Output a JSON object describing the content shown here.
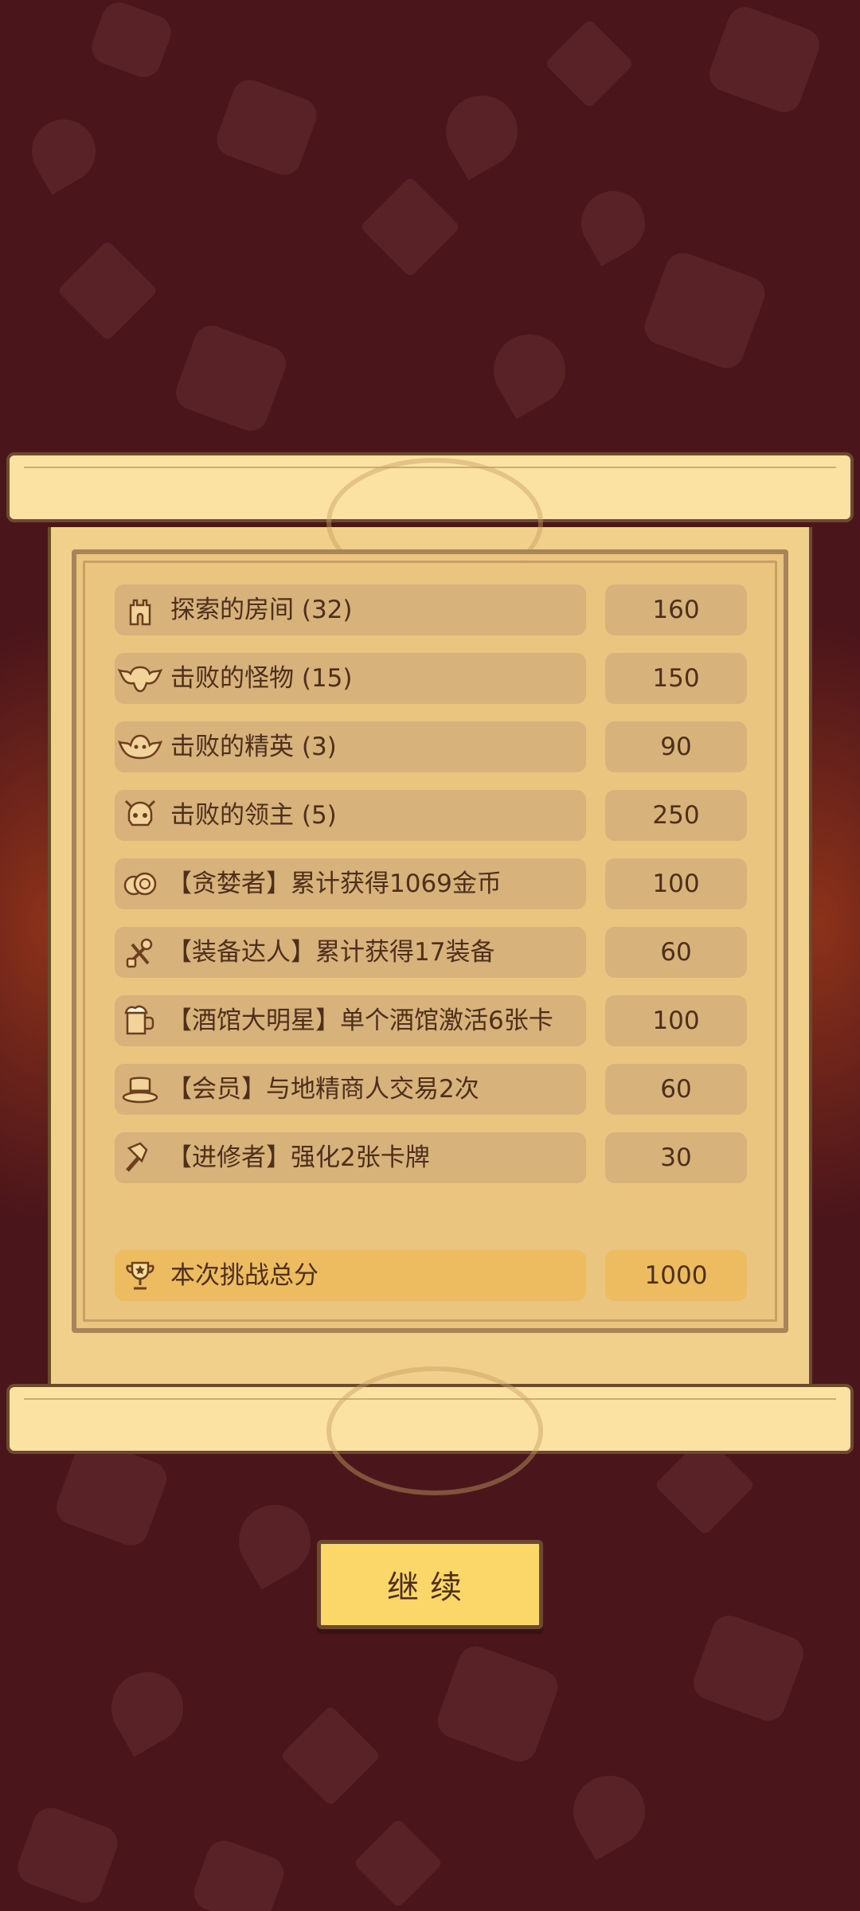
{
  "stats": {
    "rows": [
      {
        "icon": "tower-icon",
        "label": "探索的房间 (32)",
        "value": "160"
      },
      {
        "icon": "bat-icon",
        "label": "击败的怪物 (15)",
        "value": "150"
      },
      {
        "icon": "elite-monster-icon",
        "label": "击败的精英 (3)",
        "value": "90"
      },
      {
        "icon": "boss-skull-icon",
        "label": "击败的领主 (5)",
        "value": "250"
      },
      {
        "icon": "coins-icon",
        "label": "【贪婪者】累计获得1069金币",
        "value": "100"
      },
      {
        "icon": "equipment-icon",
        "label": "【装备达人】累计获得17装备",
        "value": "60"
      },
      {
        "icon": "beer-mug-icon",
        "label": "【酒馆大明星】单个酒馆激活6张卡",
        "value": "100"
      },
      {
        "icon": "top-hat-icon",
        "label": "【会员】与地精商人交易2次",
        "value": "60"
      },
      {
        "icon": "hammer-icon",
        "label": "【进修者】强化2张卡牌",
        "value": "30"
      }
    ],
    "total": {
      "icon": "trophy-icon",
      "label": "本次挑战总分",
      "value": "1000"
    }
  },
  "continue_button": {
    "label": "继续"
  },
  "colors": {
    "background": "#4a151b",
    "parchment": "#f0d08a",
    "pill": "#d7b27a",
    "total_pill": "#edbc60",
    "button": "#fbd76a",
    "text": "#4d2f1c"
  }
}
